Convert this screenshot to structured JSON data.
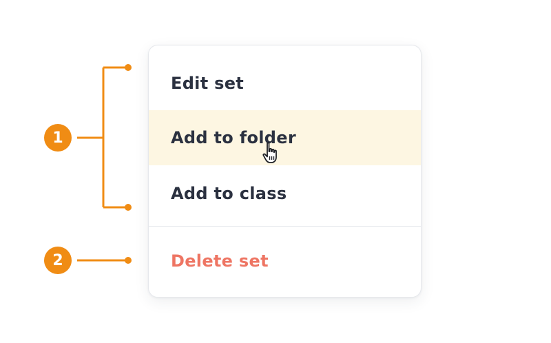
{
  "menu": {
    "items": [
      {
        "label": "Edit set",
        "state": "default"
      },
      {
        "label": "Add to folder",
        "state": "hovered"
      },
      {
        "label": "Add to class",
        "state": "default"
      },
      {
        "label": "Delete set",
        "state": "danger"
      }
    ]
  },
  "callouts": [
    {
      "number": "1"
    },
    {
      "number": "2"
    }
  ],
  "colors": {
    "accent": "#f08c14",
    "hover_background": "#fdf6e2",
    "text": "#2b3140",
    "danger": "#ee7563",
    "border": "#e6e8ec"
  },
  "cursor_icon": "hand-pointer-icon"
}
